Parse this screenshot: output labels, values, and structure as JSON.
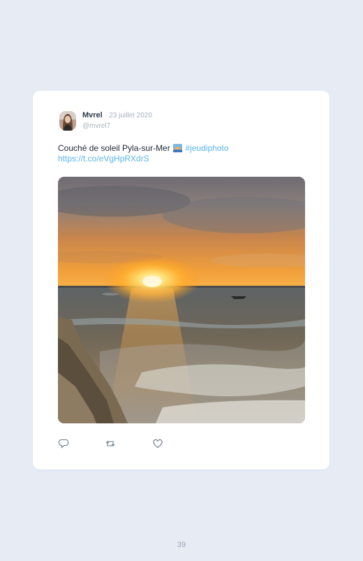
{
  "tweet": {
    "author": {
      "display_name": "Mvrel",
      "separator": "·",
      "date": "23 juillet 2020",
      "handle": "@mvrel7"
    },
    "text": "Couché de soleil Pyla-sur-Mer",
    "emoji": "sunrise-emoji",
    "hashtag": "#jeudiphoto",
    "link": "https://t.co/eVgHpRXdrS",
    "photo": "sunset-over-sea-photo",
    "actions": [
      "reply-icon",
      "retweet-icon",
      "like-icon"
    ]
  },
  "page": {
    "number": "39"
  },
  "colors": {
    "background": "#e6ebf4",
    "card": "#ffffff",
    "link": "#59b6e8",
    "muted": "#a8b1bf"
  }
}
